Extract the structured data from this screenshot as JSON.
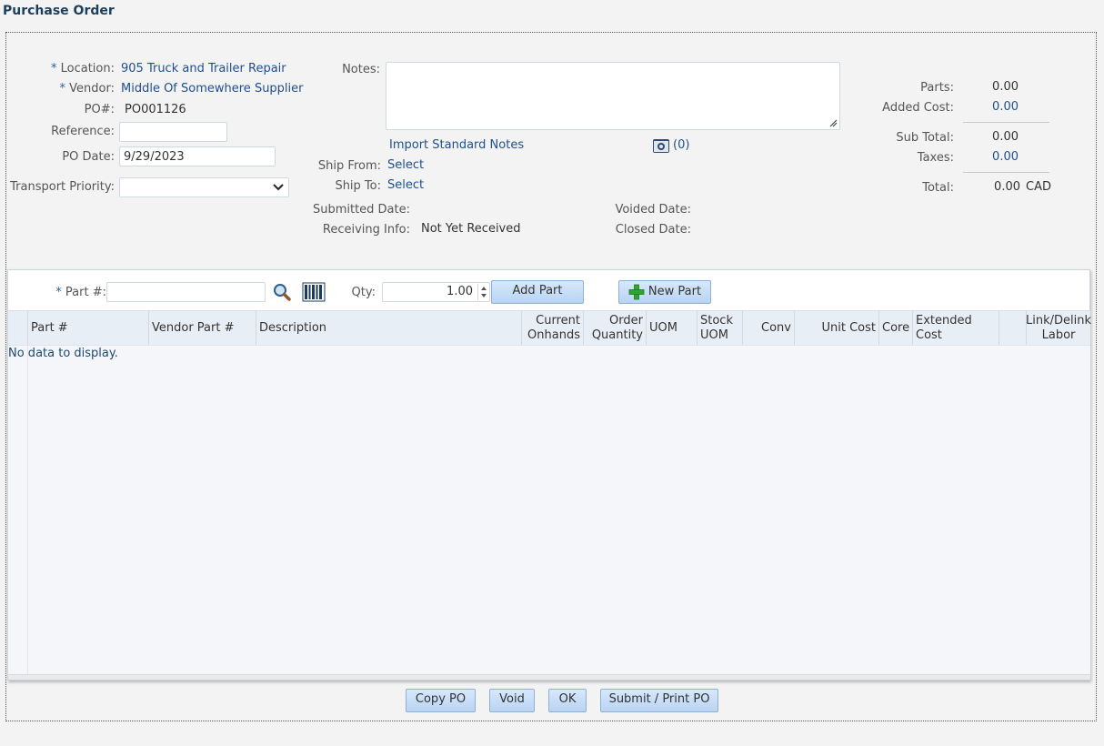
{
  "page": {
    "title": "Purchase Order"
  },
  "form": {
    "location_label": "Location:",
    "location_value": "905 Truck and Trailer Repair",
    "vendor_label": "Vendor:",
    "vendor_value": "Middle Of Somewhere Supplier",
    "po_label": "PO#:",
    "po_value": "PO001126",
    "reference_label": "Reference:",
    "reference_value": "",
    "po_date_label": "PO Date:",
    "po_date_value": "9/29/2023",
    "transport_label": "Transport Priority:",
    "transport_value": "",
    "required_mark": "*"
  },
  "notes": {
    "label": "Notes:",
    "value": "",
    "import_link": "Import Standard Notes",
    "attachments_count": "(0)",
    "ship_from_label": "Ship From:",
    "ship_from_value": "Select",
    "ship_to_label": "Ship To:",
    "ship_to_value": "Select",
    "submitted_label": "Submitted Date:",
    "receiving_label": "Receiving Info:",
    "receiving_value": "Not Yet Received",
    "voided_label": "Voided Date:",
    "closed_label": "Closed Date:"
  },
  "totals": {
    "parts_label": "Parts:",
    "parts_value": "0.00",
    "added_cost_label": "Added Cost:",
    "added_cost_value": "0.00",
    "subtotal_label": "Sub Total:",
    "subtotal_value": "0.00",
    "taxes_label": "Taxes:",
    "taxes_value": "0.00",
    "total_label": "Total:",
    "total_value": "0.00",
    "currency": "CAD"
  },
  "part_bar": {
    "part_label": "Part #:",
    "part_value": "",
    "qty_label": "Qty:",
    "qty_value": "1.00",
    "add_part": "Add Part",
    "new_part": "New Part"
  },
  "grid": {
    "columns": [
      "Part #",
      "Vendor Part #",
      "Description",
      "Current Onhands",
      "Order Quantity",
      "UOM",
      "Stock UOM",
      "Conv",
      "Unit Cost",
      "Core",
      "Extended Cost",
      "",
      "Link/Delink Labor"
    ],
    "col_lines": [
      [
        "Current",
        "Onhands"
      ],
      [
        "Order",
        "Quantity"
      ],
      [
        "Stock",
        "UOM"
      ],
      [
        "Link/Delink",
        "Labor"
      ]
    ],
    "empty_text": "No data to display."
  },
  "footer": {
    "copy_po": "Copy PO",
    "void": "Void",
    "ok": "OK",
    "submit_print": "Submit / Print PO"
  },
  "colors": {
    "link": "#1f4f8f",
    "button_top": "#d7e8fb",
    "button_bottom": "#b9d4f2",
    "new_part_icon": "#2fa52f"
  },
  "icons": {
    "search": "search-icon",
    "barcode": "barcode-icon",
    "camera": "camera-icon",
    "plus": "plus-icon",
    "dropdown": "chevron-down-icon"
  }
}
